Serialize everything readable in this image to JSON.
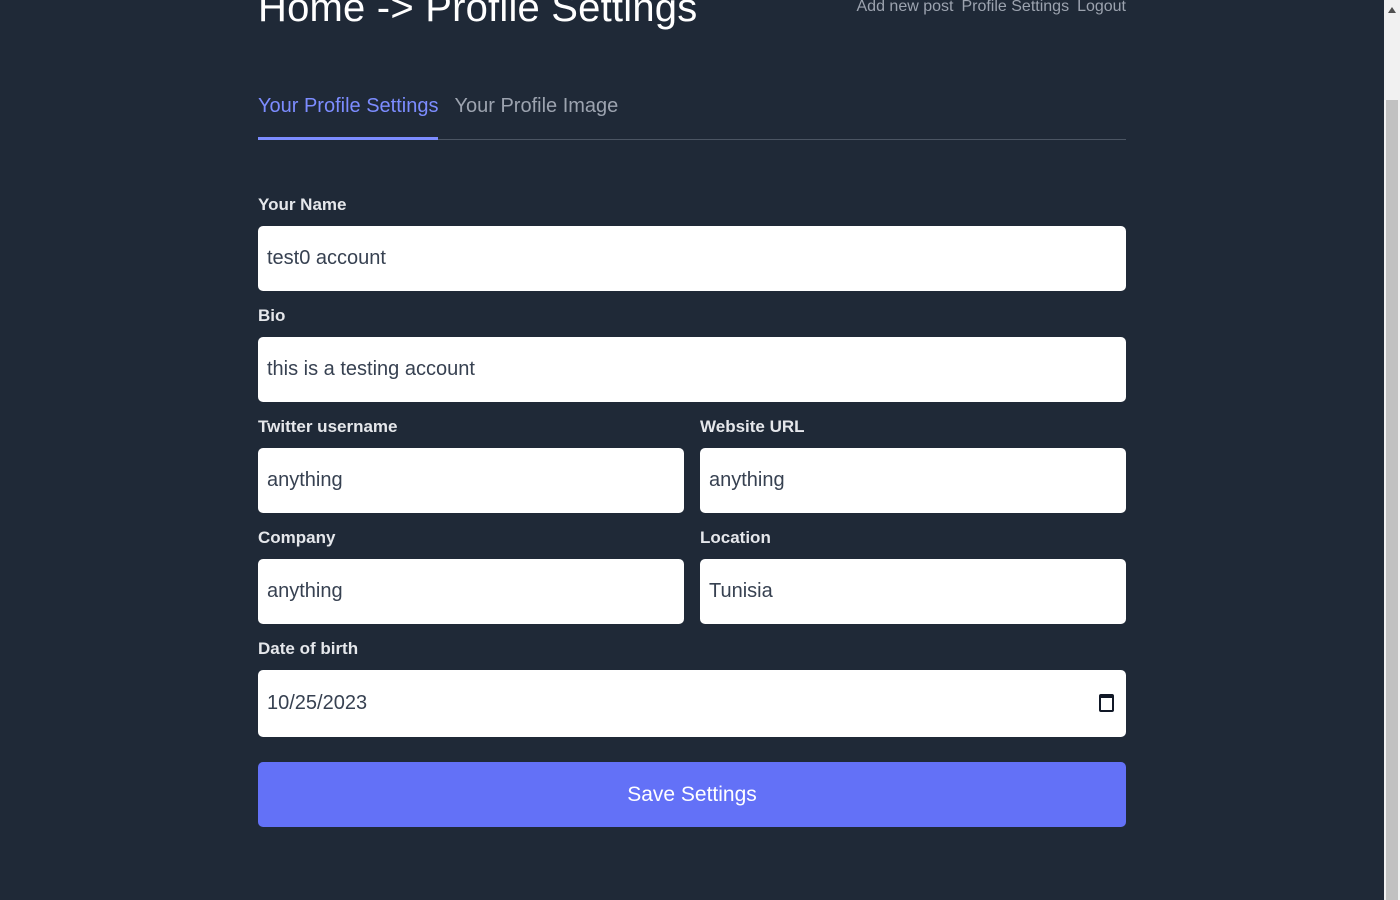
{
  "header": {
    "title": "Home -> Profile Settings",
    "nav": [
      "Add new post",
      "Profile Settings",
      "Logout"
    ]
  },
  "tabs": [
    {
      "label": "Your Profile Settings",
      "active": true
    },
    {
      "label": "Your Profile Image",
      "active": false
    }
  ],
  "form": {
    "name": {
      "label": "Your Name",
      "value": "test0 account"
    },
    "bio": {
      "label": "Bio",
      "value": "this is a testing account"
    },
    "twitter": {
      "label": "Twitter username",
      "value": "anything"
    },
    "website": {
      "label": "Website URL",
      "value": "anything"
    },
    "company": {
      "label": "Company",
      "value": "anything"
    },
    "location": {
      "label": "Location",
      "value": "Tunisia"
    },
    "dob": {
      "label": "Date of birth",
      "value": "10/25/2023"
    },
    "save_label": "Save Settings"
  },
  "icons": {
    "calendar": "calendar-icon",
    "scroll_up": "arrow-up-icon"
  },
  "colors": {
    "background": "#1f2937",
    "accent": "#6371f7",
    "tab_active": "#7c8cff"
  }
}
